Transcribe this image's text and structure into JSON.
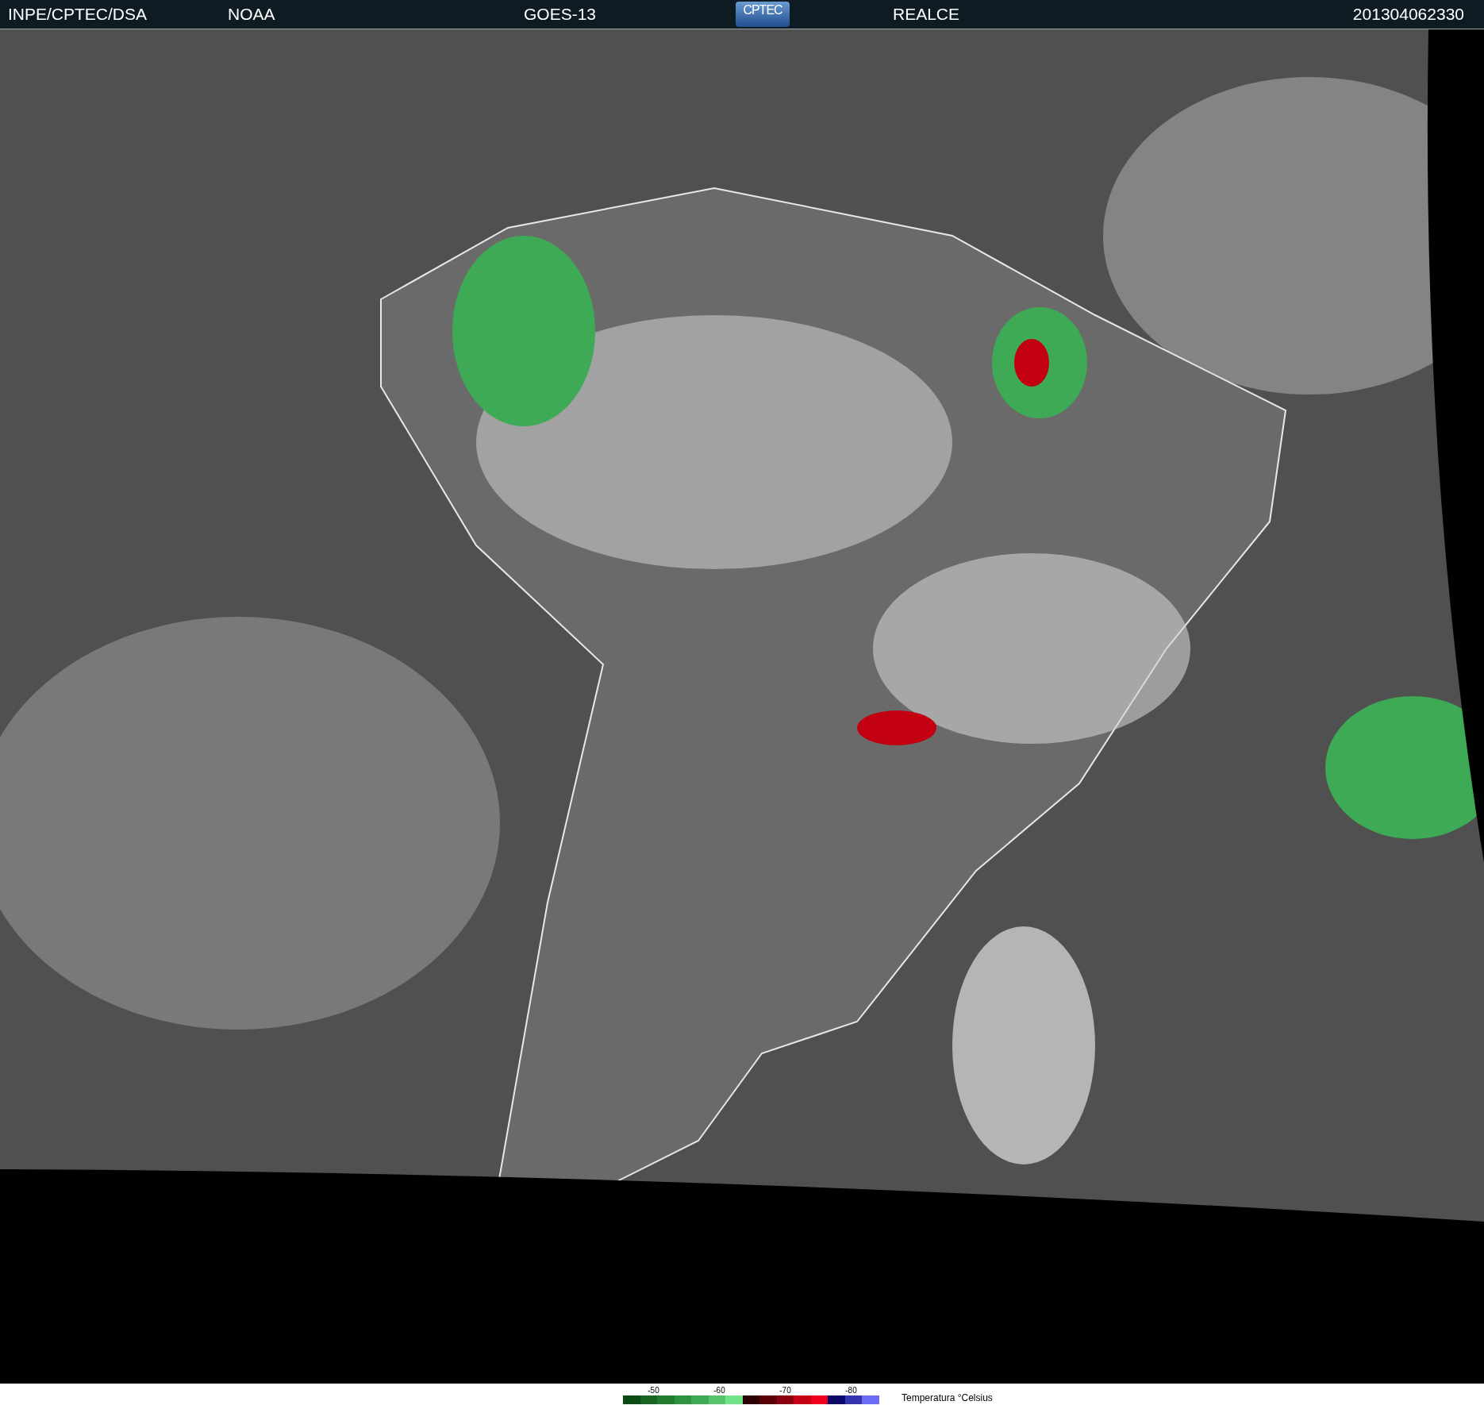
{
  "header": {
    "source": "INPE/CPTEC/DSA",
    "agency": "NOAA",
    "satellite": "GOES-13",
    "logo": "CPTEC",
    "product": "REALCE",
    "timestamp": "201304062330"
  },
  "legend": {
    "ticks": [
      "-50",
      "-60",
      "-70",
      "-80"
    ],
    "swatches": [
      {
        "color": "#0b4a12"
      },
      {
        "color": "#17631f"
      },
      {
        "color": "#217a2d"
      },
      {
        "color": "#2e9341"
      },
      {
        "color": "#3eaa55"
      },
      {
        "color": "#55c46c"
      },
      {
        "color": "#72e487"
      },
      {
        "color": "#2a0004"
      },
      {
        "color": "#5a0008"
      },
      {
        "color": "#8a000e"
      },
      {
        "color": "#c30012"
      },
      {
        "color": "#f0001a"
      },
      {
        "color": "#0a0868"
      },
      {
        "color": "#3434b0"
      },
      {
        "color": "#6c6cf5"
      }
    ],
    "title": "Temperatura °Celsius"
  }
}
